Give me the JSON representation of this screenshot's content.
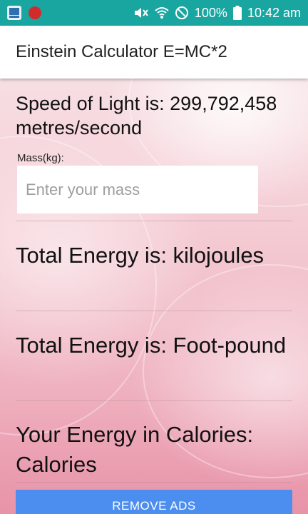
{
  "status_bar": {
    "battery": "100%",
    "time": "10:42 am"
  },
  "app_bar": {
    "title": "Einstein Calculator E=MC*2"
  },
  "main": {
    "speed_of_light": "Speed of Light is: 299,792,458 metres/second",
    "mass_label": "Mass(kg):",
    "mass_value": "",
    "mass_placeholder": "Enter your mass",
    "results": [
      {
        "text": "Total Energy is: kilojoules"
      },
      {
        "text": "Total Energy is: Foot-pound"
      },
      {
        "text": "Your Energy in Calories: Calories"
      }
    ]
  },
  "ads": {
    "button_label": "REMOVE ADS",
    "button_color": "#4c8ef0"
  },
  "colors": {
    "status_bar": "#1aa6a0",
    "app_bar": "#ffffff"
  }
}
